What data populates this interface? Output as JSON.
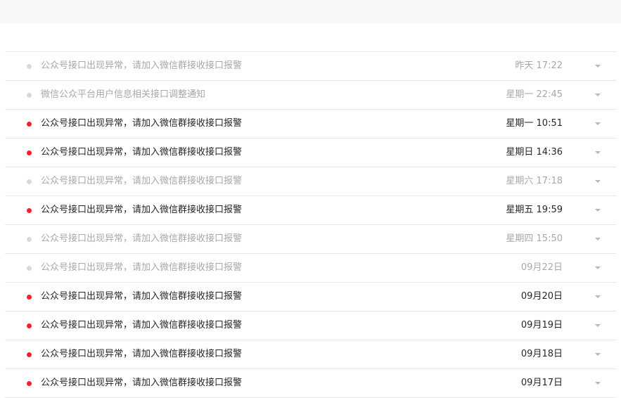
{
  "colors": {
    "unread_dot": "#f5222d",
    "read_dot": "#d9d9d9",
    "unread_text": "#262626",
    "read_text": "#a8a8a8",
    "topbar_bg": "#f6f7f9"
  },
  "notifications": [
    {
      "title": "公众号接口出现异常，请加入微信群接收接口报警",
      "time": "昨天 17:22",
      "unread": false
    },
    {
      "title": "微信公众平台用户信息相关接口调整通知",
      "time": "星期一 22:45",
      "unread": false
    },
    {
      "title": "公众号接口出现异常，请加入微信群接收接口报警",
      "time": "星期一 10:51",
      "unread": true
    },
    {
      "title": "公众号接口出现异常，请加入微信群接收接口报警",
      "time": "星期日 14:36",
      "unread": true
    },
    {
      "title": "公众号接口出现异常，请加入微信群接收接口报警",
      "time": "星期六 17:18",
      "unread": false
    },
    {
      "title": "公众号接口出现异常，请加入微信群接收接口报警",
      "time": "星期五 19:59",
      "unread": true
    },
    {
      "title": "公众号接口出现异常，请加入微信群接收接口报警",
      "time": "星期四 15:50",
      "unread": false
    },
    {
      "title": "公众号接口出现异常，请加入微信群接收接口报警",
      "time": "09月22日",
      "unread": false
    },
    {
      "title": "公众号接口出现异常，请加入微信群接收接口报警",
      "time": "09月20日",
      "unread": true
    },
    {
      "title": "公众号接口出现异常，请加入微信群接收接口报警",
      "time": "09月19日",
      "unread": true
    },
    {
      "title": "公众号接口出现异常，请加入微信群接收接口报警",
      "time": "09月18日",
      "unread": true
    },
    {
      "title": "公众号接口出现异常，请加入微信群接收接口报警",
      "time": "09月17日",
      "unread": true
    }
  ]
}
